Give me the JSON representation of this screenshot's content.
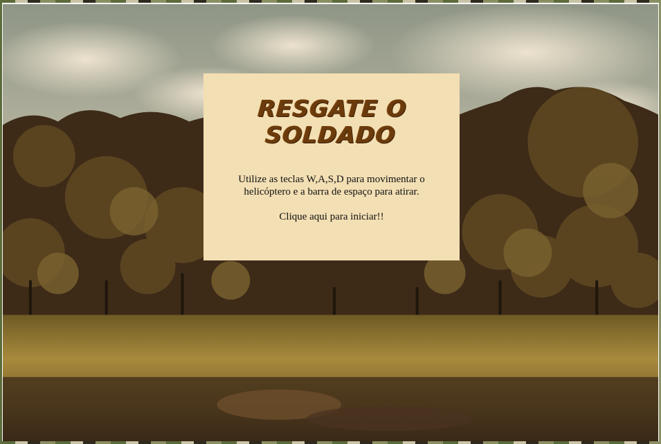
{
  "game": {
    "title": "RESGATE O SOLDADO",
    "instructions": "Utilize as teclas W,A,S,D para movimentar o helicóptero e a barra de espaço para atirar.",
    "start_prompt": "Clique aqui para iniciar!!"
  },
  "colors": {
    "panel_background": "#f3dfb4",
    "title_color": "#6b3b0c",
    "text_color": "#111111"
  }
}
